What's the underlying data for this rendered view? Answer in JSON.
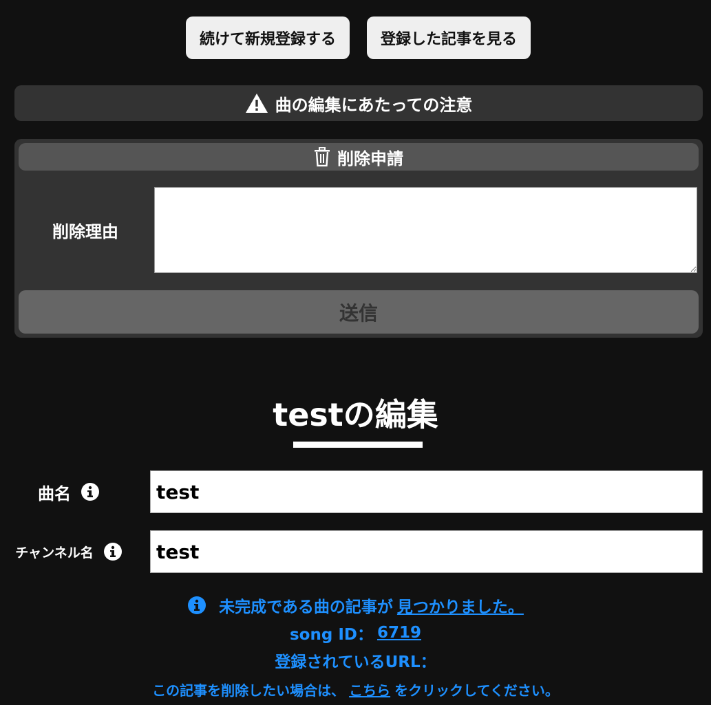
{
  "top_buttons": {
    "continue_label": "続けて新規登録する",
    "view_label": "登録した記事を見る"
  },
  "notice": {
    "label": "曲の編集にあたっての注意",
    "icon": "warning-icon"
  },
  "delete_request": {
    "header": "削除申請",
    "icon": "trash-icon",
    "reason_label": "削除理由",
    "reason_value": "",
    "submit_label": "送信"
  },
  "edit": {
    "title": "testの編集"
  },
  "fields": {
    "song_label": "曲名",
    "song_value": "test",
    "channel_label": "チャンネル名",
    "channel_value": "test"
  },
  "info": {
    "found_prefix": "未完成である曲の記事が",
    "found_link": "見つかりました。",
    "song_id_label": "song ID：",
    "song_id_value": "6719",
    "url_label": "登録されているURL：",
    "delete_prefix": "この記事を削除したい場合は、",
    "delete_link": "こちら",
    "delete_suffix": "をクリックしてください。"
  },
  "colors": {
    "background": "#111111",
    "panel": "#333333",
    "accent": "#1e90ff"
  }
}
